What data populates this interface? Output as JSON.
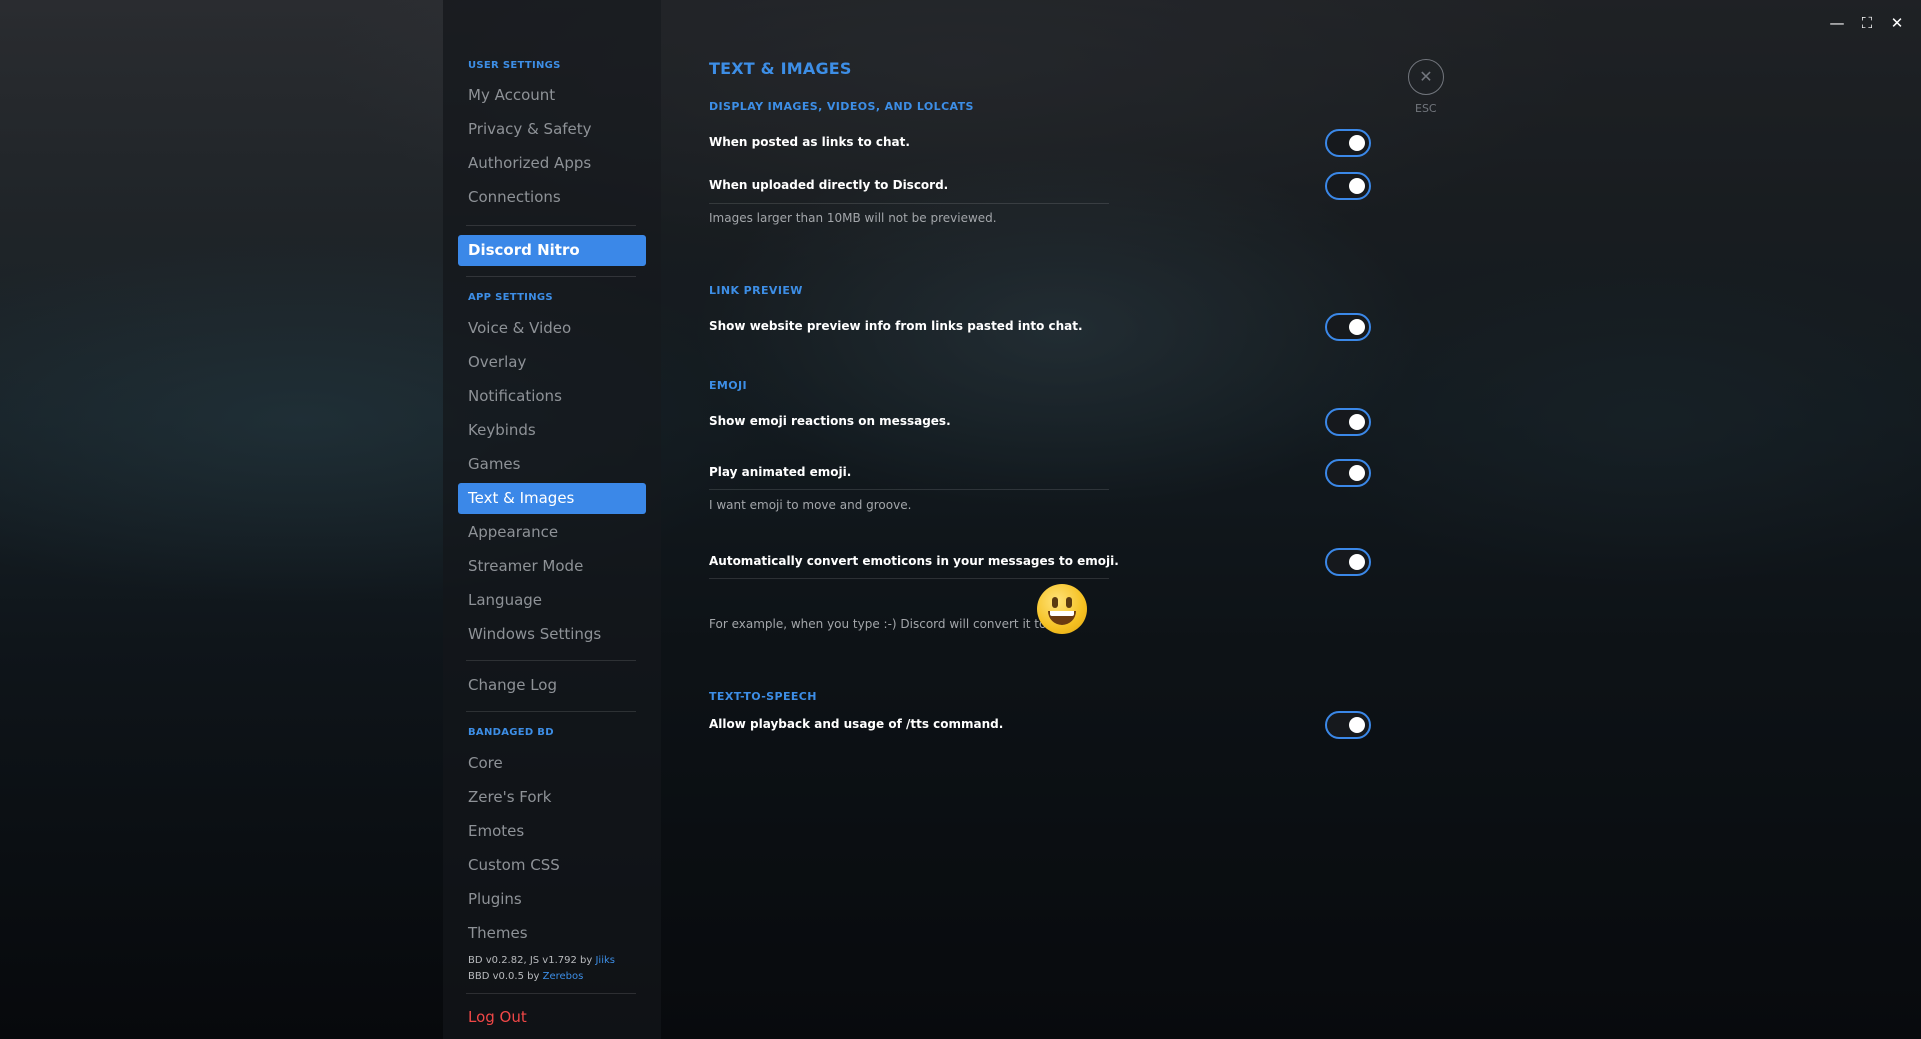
{
  "sidebar": {
    "user_settings_header": "USER SETTINGS",
    "user_items": [
      "My Account",
      "Privacy & Safety",
      "Authorized Apps",
      "Connections"
    ],
    "nitro_label": "Discord Nitro",
    "app_settings_header": "APP SETTINGS",
    "app_items": [
      "Voice & Video",
      "Overlay",
      "Notifications",
      "Keybinds",
      "Games",
      "Text & Images",
      "Appearance",
      "Streamer Mode",
      "Language",
      "Windows Settings"
    ],
    "active_item": "Text & Images",
    "change_log": "Change Log",
    "bd_header": "BANDAGED BD",
    "bd_items": [
      "Core",
      "Zere's Fork",
      "Emotes",
      "Custom CSS",
      "Plugins",
      "Themes"
    ],
    "version_line1_prefix": "BD v0.2.82, JS v1.792 by ",
    "version_line1_author": "Jiiks",
    "version_line2_prefix": "BBD v0.0.5 by ",
    "version_line2_author": "Zerebos",
    "log_out": "Log Out"
  },
  "main": {
    "page_title": "TEXT & IMAGES",
    "sections": {
      "display": {
        "title": "DISPLAY IMAGES, VIDEOS, AND LOLCATS",
        "setting1": "When posted as links to chat.",
        "setting2": "When uploaded directly to Discord.",
        "note": "Images larger than 10MB will not be previewed."
      },
      "link_preview": {
        "title": "LINK PREVIEW",
        "setting1": "Show website preview info from links pasted into chat."
      },
      "emoji": {
        "title": "EMOJI",
        "setting1": "Show emoji reactions on messages.",
        "setting2": "Play animated emoji.",
        "note": "I want emoji to move and groove.",
        "setting3": "Automatically convert emoticons in your messages to emoji.",
        "example": "For example, when you type :-) Discord will convert it to"
      },
      "tts": {
        "title": "TEXT-TO-SPEECH",
        "setting1": "Allow playback and usage of /tts command."
      }
    },
    "toggles": {
      "links_to_chat": true,
      "uploaded_directly": true,
      "link_preview": true,
      "emoji_reactions": true,
      "animated_emoji": true,
      "convert_emoticons": true,
      "tts": true
    },
    "accent_color": "#3b88e8",
    "esc_label": "ESC"
  },
  "window_controls": {
    "minimize": "minimize-icon",
    "maximize": "maximize-icon",
    "close": "close-icon"
  }
}
